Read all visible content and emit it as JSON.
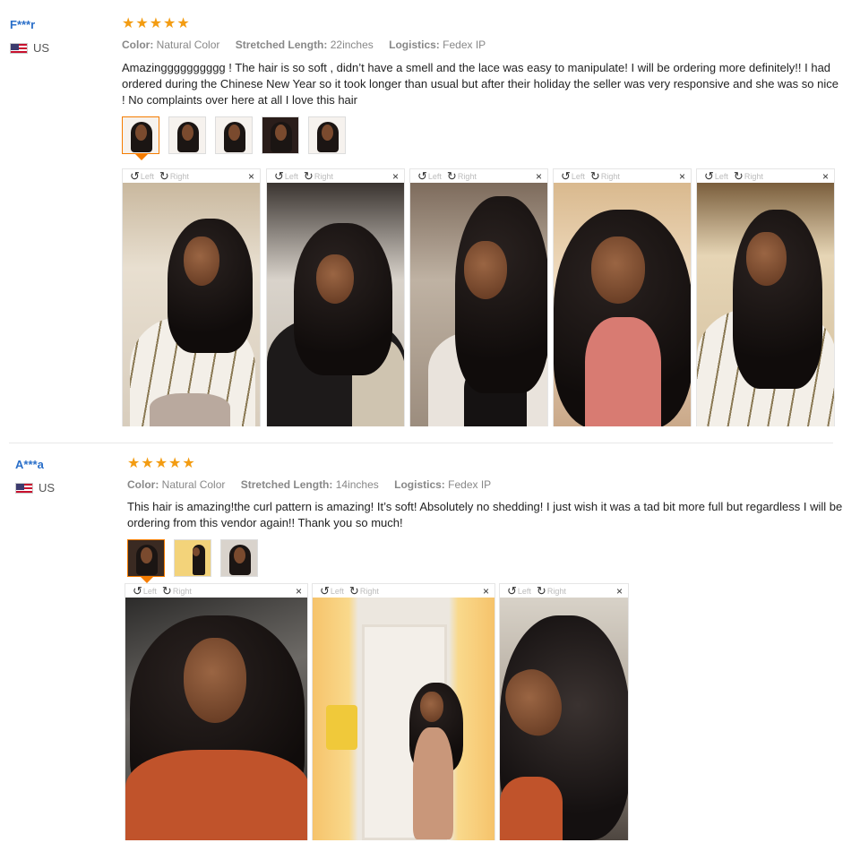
{
  "reviews": [
    {
      "user": "F***r",
      "country": "US",
      "rating": 5,
      "attrs": [
        {
          "key": "Color:",
          "value": "Natural Color"
        },
        {
          "key": "Stretched Length:",
          "value": "22inches"
        },
        {
          "key": "Logistics:",
          "value": "Fedex IP"
        }
      ],
      "text": "Amazingggggggggg ! The hair is so soft , didn’t have a smell and the lace was easy to manipulate! I will be ordering more definitely!! I had ordered during the Chinese New Year so it took longer than usual but after their holiday the seller was very responsive and she was so nice ! No complaints over here at all I love this hair",
      "photo_count": 5
    },
    {
      "user": "A***a",
      "country": "US",
      "rating": 5,
      "attrs": [
        {
          "key": "Color:",
          "value": "Natural Color"
        },
        {
          "key": "Stretched Length:",
          "value": "14inches"
        },
        {
          "key": "Logistics:",
          "value": "Fedex IP"
        }
      ],
      "text": "This hair is amazing!the curl pattern is amazing! It’s soft! Absolutely no shedding! I just wish it was a tad bit more full but regardless I will be ordering from this vendor again!! Thank you so much!",
      "photo_count": 3
    }
  ],
  "photo_controls": {
    "left_label": "Left",
    "right_label": "Right",
    "close_symbol": "×",
    "rotate_left_icon": "↺",
    "rotate_right_icon": "↻"
  },
  "star_symbol": "★",
  "colors": {
    "username": "#2a6fc9",
    "star": "#f39c12",
    "active_thumb": "#f57c00"
  }
}
